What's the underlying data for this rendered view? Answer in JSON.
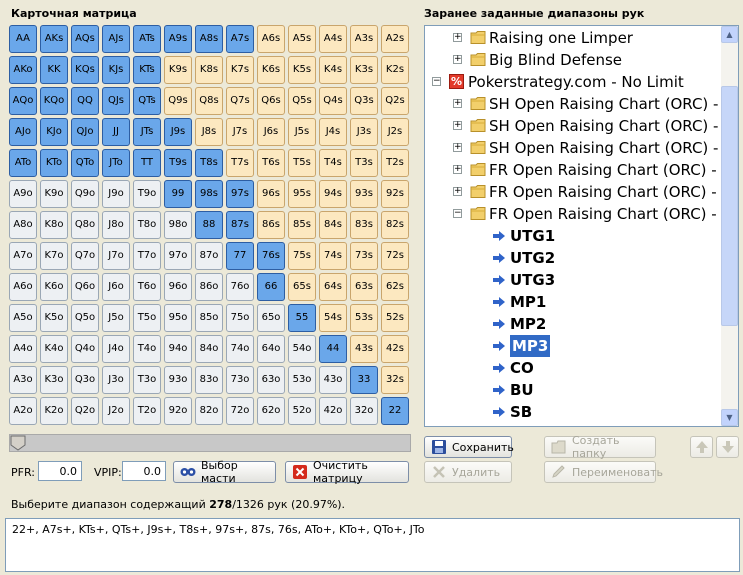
{
  "left_panel": {
    "title": "Карточная матрица"
  },
  "right_panel": {
    "title": "Заранее заданные диапазоны рук"
  },
  "colors": {
    "selected": "#6aa7ea",
    "suited": "#fce8c0",
    "offsuit": "#edf0f3",
    "tree_highlight": "#316ac5"
  },
  "matrix": {
    "ranks": [
      "A",
      "K",
      "Q",
      "J",
      "T",
      "9",
      "8",
      "7",
      "6",
      "5",
      "4",
      "3",
      "2"
    ],
    "selected": [
      "AA",
      "AKs",
      "AQs",
      "AJs",
      "ATs",
      "A9s",
      "A8s",
      "A7s",
      "AKo",
      "KK",
      "KQs",
      "KJs",
      "KTs",
      "AQo",
      "KQo",
      "QQ",
      "QJs",
      "QTs",
      "AJo",
      "KJo",
      "QJo",
      "JJ",
      "JTs",
      "J9s",
      "ATo",
      "KTo",
      "QTo",
      "JTo",
      "TT",
      "T9s",
      "T8s",
      "99",
      "98s",
      "97s",
      "88",
      "87s",
      "77",
      "76s",
      "66",
      "55",
      "44",
      "33",
      "22"
    ]
  },
  "controls": {
    "pfr_label": "PFR:",
    "pfr_value": "0.0",
    "vpip_label": "VPIP:",
    "vpip_value": "0.0",
    "suits_button": "Выбор масти",
    "clear_button": "Очистить матрицу"
  },
  "status": {
    "prefix": "Выберите диапазон содержащий ",
    "count": "278",
    "suffix": "/1326 рук (20.97%)."
  },
  "range_text": "22+, A7s+, KTs+, QTs+, J9s+, T8s+, 97s+, 87s, 76s, ATo+, KTo+, QTo+, JTo",
  "tree": {
    "folders": [
      {
        "label": "Raising one Limper",
        "expander": "+"
      },
      {
        "label": "Big Blind Defense",
        "expander": "+"
      }
    ],
    "root": {
      "label": "Pokerstrategy.com - No Limit",
      "expander": "−",
      "icon": "pokerstrategy-icon"
    },
    "subfolders": [
      {
        "label": "SH Open Raising Chart (ORC) - S",
        "expander": "+"
      },
      {
        "label": "SH Open Raising Chart (ORC) - T",
        "expander": "+"
      },
      {
        "label": "SH Open Raising Chart (ORC) - L",
        "expander": "+"
      },
      {
        "label": "FR Open Raising Chart (ORC) - S",
        "expander": "+"
      },
      {
        "label": "FR Open Raising Chart (ORC) - T",
        "expander": "+"
      },
      {
        "label": "FR Open Raising Chart (ORC) - L",
        "expander": "−"
      }
    ],
    "leaves": [
      "UTG1",
      "UTG2",
      "UTG3",
      "MP1",
      "MP2",
      "MP3",
      "CO",
      "BU",
      "SB"
    ],
    "active_leaf": "MP3"
  },
  "actions": {
    "save": "Сохранить",
    "create_folder": "Создать папку",
    "delete": "Удалить",
    "rename": "Переименовать"
  }
}
